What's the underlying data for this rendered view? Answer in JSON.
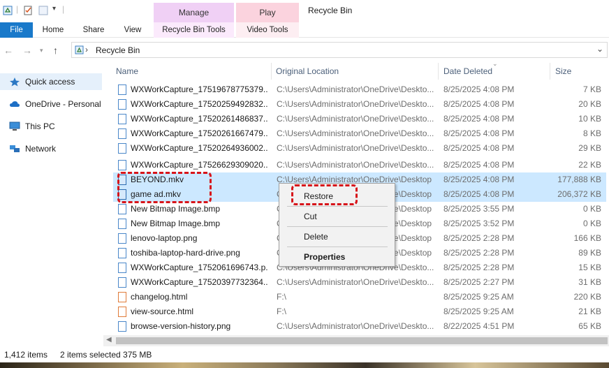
{
  "window": {
    "title": "Recycle Bin"
  },
  "context_tabs": {
    "manage": "Manage",
    "play": "Play"
  },
  "ribbon": {
    "tabs": [
      "File",
      "Home",
      "Share",
      "View",
      "Recycle Bin Tools",
      "Video Tools"
    ]
  },
  "address": {
    "path": "Recycle Bin"
  },
  "sidebar": {
    "items": [
      "Quick access",
      "OneDrive - Personal",
      "This PC",
      "Network"
    ]
  },
  "columns": {
    "name": "Name",
    "original_location": "Original Location",
    "date_deleted": "Date Deleted",
    "size": "Size"
  },
  "rows": [
    {
      "name": "WXWorkCapture_17519678775379....",
      "location": "C:\\Users\\Administrator\\OneDrive\\Deskto...",
      "date": "8/25/2025 4:08 PM",
      "size": "7 KB"
    },
    {
      "name": "WXWorkCapture_17520259492832....",
      "location": "C:\\Users\\Administrator\\OneDrive\\Deskto...",
      "date": "8/25/2025 4:08 PM",
      "size": "20 KB"
    },
    {
      "name": "WXWorkCapture_17520261486837....",
      "location": "C:\\Users\\Administrator\\OneDrive\\Deskto...",
      "date": "8/25/2025 4:08 PM",
      "size": "10 KB"
    },
    {
      "name": "WXWorkCapture_17520261667479....",
      "location": "C:\\Users\\Administrator\\OneDrive\\Deskto...",
      "date": "8/25/2025 4:08 PM",
      "size": "8 KB"
    },
    {
      "name": "WXWorkCapture_17520264936002....",
      "location": "C:\\Users\\Administrator\\OneDrive\\Deskto...",
      "date": "8/25/2025 4:08 PM",
      "size": "29 KB"
    },
    {
      "name": "WXWorkCapture_17526629309020....",
      "location": "C:\\Users\\Administrator\\OneDrive\\Deskto...",
      "date": "8/25/2025 4:08 PM",
      "size": "22 KB"
    },
    {
      "name": "BEYOND.mkv",
      "location": "C:\\Users\\Administrator\\OneDrive\\Desktop",
      "date": "8/25/2025 4:08 PM",
      "size": "177,888 KB"
    },
    {
      "name": "game ad.mkv",
      "location": "C:\\Users\\Administrator\\OneDrive\\Desktop",
      "date": "8/25/2025 4:08 PM",
      "size": "206,372 KB"
    },
    {
      "name": "New Bitmap Image.bmp",
      "location": "C:\\Users\\Administrator\\OneDrive\\Desktop",
      "date": "8/25/2025 3:55 PM",
      "size": "0 KB"
    },
    {
      "name": "New Bitmap Image.bmp",
      "location": "C:\\Users\\Administrator\\OneDrive\\Desktop",
      "date": "8/25/2025 3:52 PM",
      "size": "0 KB"
    },
    {
      "name": "lenovo-laptop.png",
      "location": "C:\\Users\\Administrator\\OneDrive\\Desktop",
      "date": "8/25/2025 2:28 PM",
      "size": "166 KB"
    },
    {
      "name": "toshiba-laptop-hard-drive.png",
      "location": "C:\\Users\\Administrator\\OneDrive\\Desktop",
      "date": "8/25/2025 2:28 PM",
      "size": "89 KB"
    },
    {
      "name": "WXWorkCapture_1752061696743.p...",
      "location": "C:\\Users\\Administrator\\OneDrive\\Deskto...",
      "date": "8/25/2025 2:28 PM",
      "size": "15 KB"
    },
    {
      "name": "WXWorkCapture_17520397732364....",
      "location": "C:\\Users\\Administrator\\OneDrive\\Deskto...",
      "date": "8/25/2025 2:27 PM",
      "size": "31 KB"
    },
    {
      "name": "changelog.html",
      "location": "F:\\",
      "date": "8/25/2025 9:25 AM",
      "size": "220 KB"
    },
    {
      "name": "view-source.html",
      "location": "F:\\",
      "date": "8/25/2025 9:25 AM",
      "size": "21 KB"
    },
    {
      "name": "browse-version-history.png",
      "location": "C:\\Users\\Administrator\\OneDrive\\Deskto...",
      "date": "8/22/2025 4:51 PM",
      "size": "65 KB"
    }
  ],
  "context_menu": {
    "restore": "Restore",
    "cut": "Cut",
    "delete": "Delete",
    "properties": "Properties"
  },
  "status": {
    "item_count": "1,412 items",
    "selection": "2 items selected  375 MB"
  },
  "colors": {
    "accent": "#1979ca",
    "selection": "#cce8ff",
    "highlight": "#d7141a",
    "manage_tab": "#f0d0f5",
    "play_tab": "#fbd3de"
  }
}
